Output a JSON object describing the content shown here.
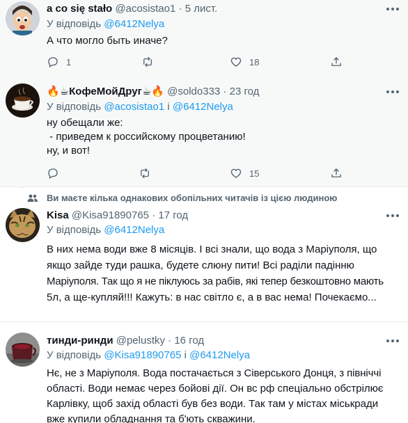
{
  "tweets": [
    {
      "name": "a co się stało",
      "handle": "@acosistao1",
      "dot": "·",
      "time": "5 лист.",
      "reply_prefix": "У відповідь",
      "reply_mentions": [
        "@6412Nelya"
      ],
      "reply_joiner": "",
      "lines": [
        "А что могло быть иначе?"
      ],
      "stats": {
        "replies": "1",
        "retweets": "",
        "likes": "18"
      }
    },
    {
      "name_prefix": "🔥☕",
      "name": "КофеМойДруг",
      "name_suffix": "☕🔥",
      "handle": "@soldo333",
      "dot": "·",
      "time": "23 год",
      "reply_prefix": "У відповідь",
      "reply_mentions": [
        "@acosistao1",
        "@6412Nelya"
      ],
      "reply_joiner": "і",
      "lines": [
        "ну обещали же:",
        " - приведем к российскому процветанию!",
        "ну, и вот!"
      ],
      "stats": {
        "replies": "",
        "retweets": "",
        "likes": "15"
      }
    },
    {
      "social_context": "Ви маєте кілька однакових обопільних читачів із цією людиною",
      "name": "Kisa",
      "handle": "@Kisa91890765",
      "dot": "·",
      "time": "17 год",
      "reply_prefix": "У відповідь",
      "reply_mentions": [
        "@6412Nelya"
      ],
      "reply_joiner": "",
      "lines": [
        "В них нема води вже 8 місяців. І всі знали, що вода з Маріуполя, що",
        "якщо зайде туди рашка, будете слюну пити! Всі раділи падінню",
        "Маріуполя. Так що я не піклуюсь за рабів, які тепер безкоштовно мають",
        "5л, а ще-купляй!!! Кажуть: в нас світло є, а в вас нема! Почекаємо..."
      ]
    },
    {
      "name": "тинди-ринди",
      "handle": "@pelustky",
      "dot": "·",
      "time": "16 год",
      "reply_prefix": "У відповідь",
      "reply_mentions": [
        "@Kisa91890765",
        "@6412Nelya"
      ],
      "reply_joiner": "і",
      "lines": [
        "Нє, не з Маріуполя. Вода постачається з Сіверського Донця, з північчі",
        "області. Води немає через бойові дії. Он вс рф спеціально обстрілює",
        "Карлівку, щоб захід області був без води. Так там у містах міськради",
        "вже купили обладнання та б'ють скважини."
      ]
    }
  ],
  "colors": {
    "link": "#1d9bf0",
    "secondary": "#536471",
    "text": "#0f1419",
    "highlight_bg": "#f7f9f9"
  },
  "icons": [
    "reply-icon",
    "retweet-icon",
    "like-icon",
    "share-icon",
    "more-icon",
    "people-icon"
  ]
}
